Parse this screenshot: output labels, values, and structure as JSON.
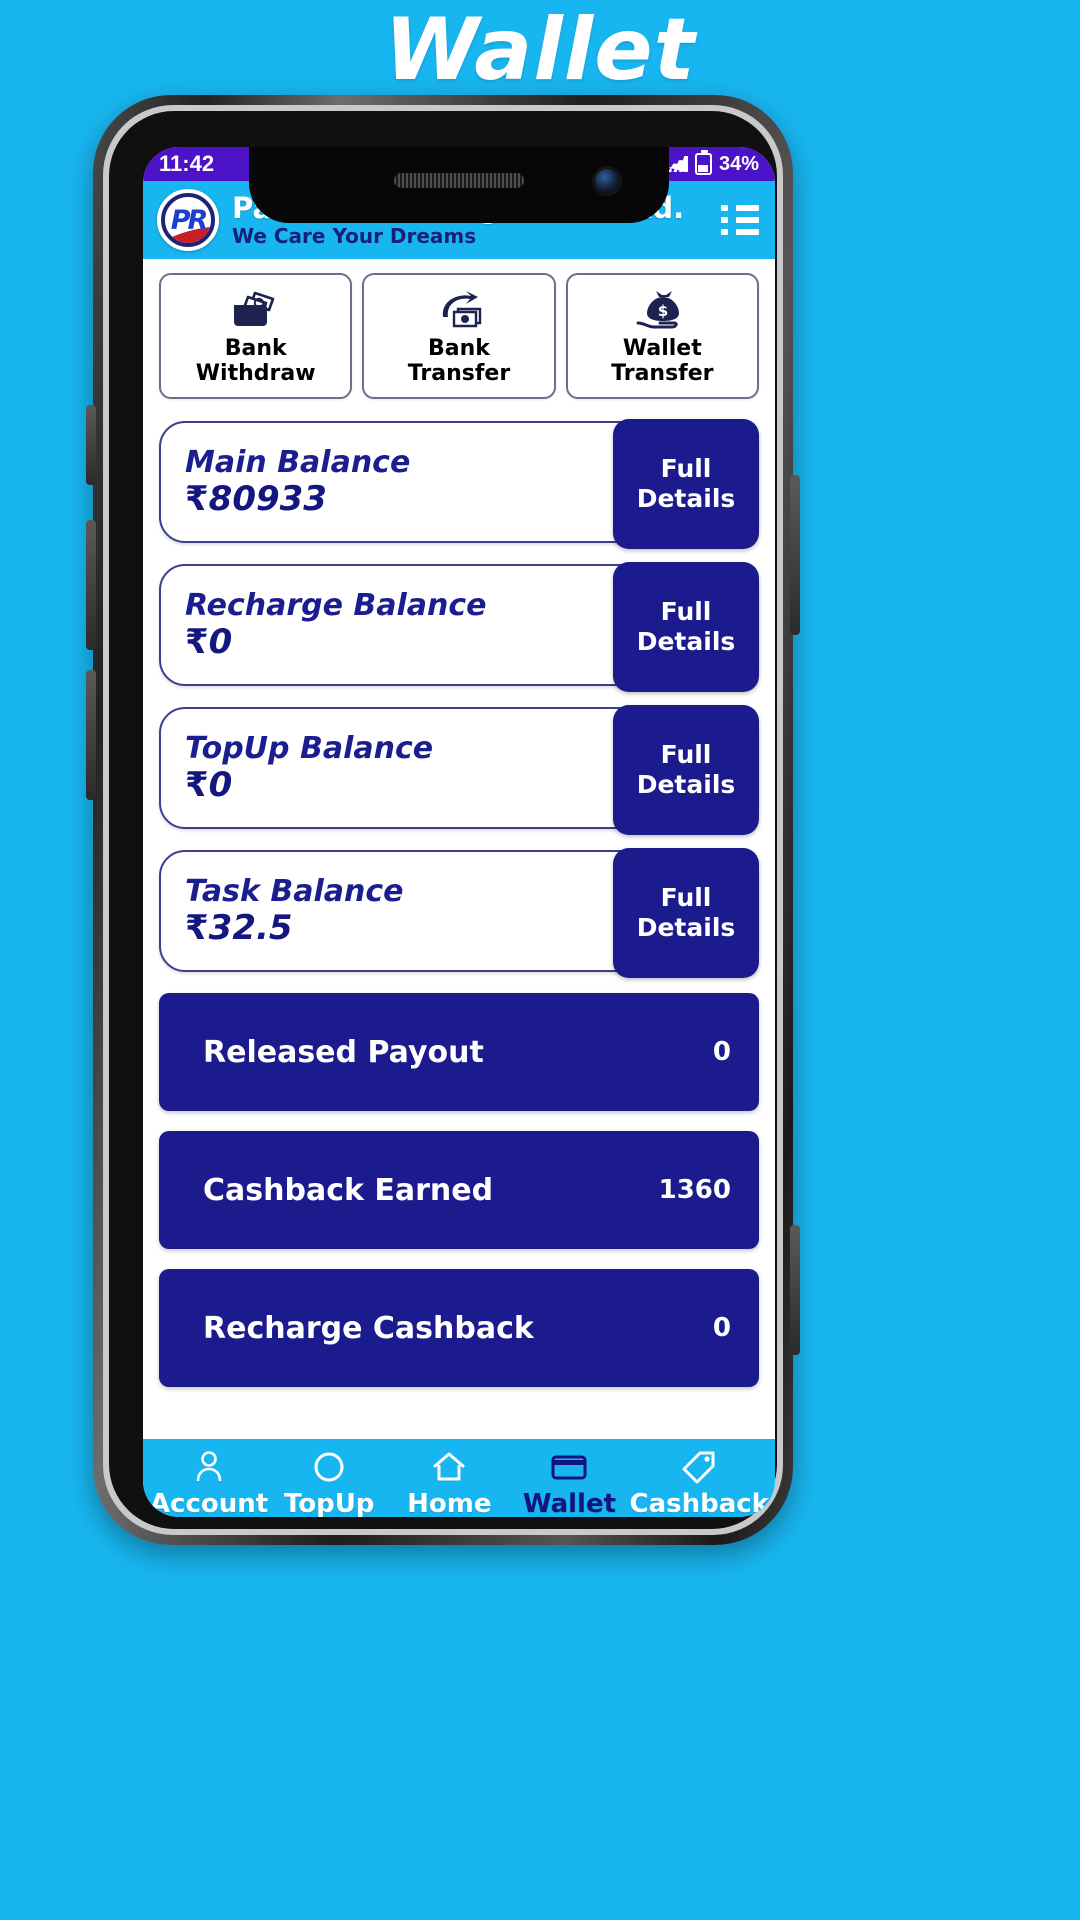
{
  "page": {
    "title": "Wallet"
  },
  "status_bar": {
    "time": "11:42",
    "battery": "34%"
  },
  "header": {
    "brand": "Passive Recharge (Pvt) Ltd.",
    "tagline": "We Care Your Dreams",
    "logo_text": "PR",
    "menu_icon": "list-menu-icon"
  },
  "quick_actions": [
    {
      "label_line1": "Bank",
      "label_line2": "Withdraw",
      "icon": "wallet-cards-icon"
    },
    {
      "label_line1": "Bank",
      "label_line2": "Transfer",
      "icon": "money-arrow-icon"
    },
    {
      "label_line1": "Wallet",
      "label_line2": "Transfer",
      "icon": "money-bag-hand-icon"
    }
  ],
  "balances": [
    {
      "title": "Main Balance",
      "currency": "₹",
      "amount": "80933",
      "button_line1": "Full",
      "button_line2": "Details"
    },
    {
      "title": "Recharge Balance",
      "currency": "₹",
      "amount": "0",
      "button_line1": "Full",
      "button_line2": "Details"
    },
    {
      "title": "TopUp Balance",
      "currency": "₹",
      "amount": "0",
      "button_line1": "Full",
      "button_line2": "Details"
    },
    {
      "title": "Task Balance",
      "currency": "₹",
      "amount": "32.5",
      "button_line1": "Full",
      "button_line2": "Details"
    }
  ],
  "stats": [
    {
      "label": "Released Payout",
      "value": "0"
    },
    {
      "label": "Cashback Earned",
      "value": "1360"
    },
    {
      "label": "Recharge Cashback",
      "value": "0"
    }
  ],
  "bottom_nav": [
    {
      "label": "Account",
      "icon": "person-icon",
      "active": false
    },
    {
      "label": "TopUp",
      "icon": "circle-icon",
      "active": false
    },
    {
      "label": "Home",
      "icon": "home-icon",
      "active": false
    },
    {
      "label": "Wallet",
      "icon": "card-icon",
      "active": true
    },
    {
      "label": "Cashback",
      "icon": "tag-icon",
      "active": false
    }
  ],
  "android_nav": [
    {
      "icon": "square-recents-icon"
    },
    {
      "icon": "circle-home-icon"
    },
    {
      "icon": "triangle-back-icon"
    }
  ],
  "colors": {
    "brand_cyan": "#18b6f0",
    "deep_blue": "#1b1b8e",
    "status_purple": "#4b12c8",
    "card_border": "#3a3f8f"
  }
}
